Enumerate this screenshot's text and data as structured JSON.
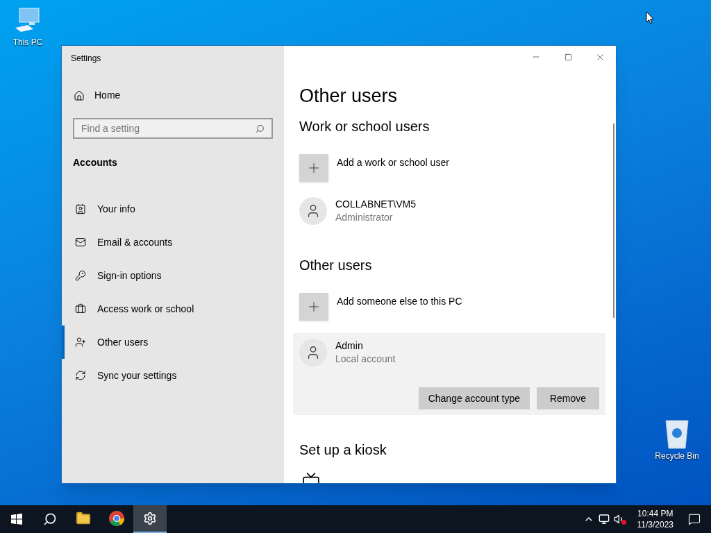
{
  "desktop_icons": [
    {
      "kind": "pc",
      "label": "This PC"
    },
    {
      "kind": "bin",
      "label": "Recycle Bin"
    }
  ],
  "window": {
    "title": "Settings"
  },
  "sidebar": {
    "home": "Home",
    "search": {
      "placeholder": "Find a setting"
    },
    "section": "Accounts",
    "items": [
      {
        "label": "Your info",
        "selected": false
      },
      {
        "label": "Email & accounts",
        "selected": false
      },
      {
        "label": "Sign-in options",
        "selected": false
      },
      {
        "label": "Access work or school",
        "selected": false
      },
      {
        "label": "Other users",
        "selected": true
      },
      {
        "label": "Sync your settings",
        "selected": false
      }
    ]
  },
  "content": {
    "title": "Other users",
    "sections": [
      {
        "heading": "Work or school users",
        "entries": [
          {
            "kind": "add",
            "label": "Add a work or school user"
          },
          {
            "kind": "user",
            "name": "COLLABNET\\VM5",
            "role": "Administrator",
            "expanded": false
          }
        ]
      },
      {
        "heading": "Other users",
        "entries": [
          {
            "kind": "add",
            "label": "Add someone else to this PC"
          },
          {
            "kind": "user",
            "name": "Admin",
            "role": "Local account",
            "expanded": true,
            "buttons": [
              "Change account type",
              "Remove"
            ]
          }
        ]
      },
      {
        "heading": "Set up a kiosk",
        "entries": [
          {
            "kind": "kiosk"
          }
        ]
      }
    ]
  },
  "taskbar": {
    "apps": [
      {
        "kind": "folder",
        "active": false
      },
      {
        "kind": "browser",
        "active": false
      },
      {
        "kind": "settings",
        "active": true
      }
    ],
    "time": "10:44 PM",
    "date": "11/3/2023"
  }
}
